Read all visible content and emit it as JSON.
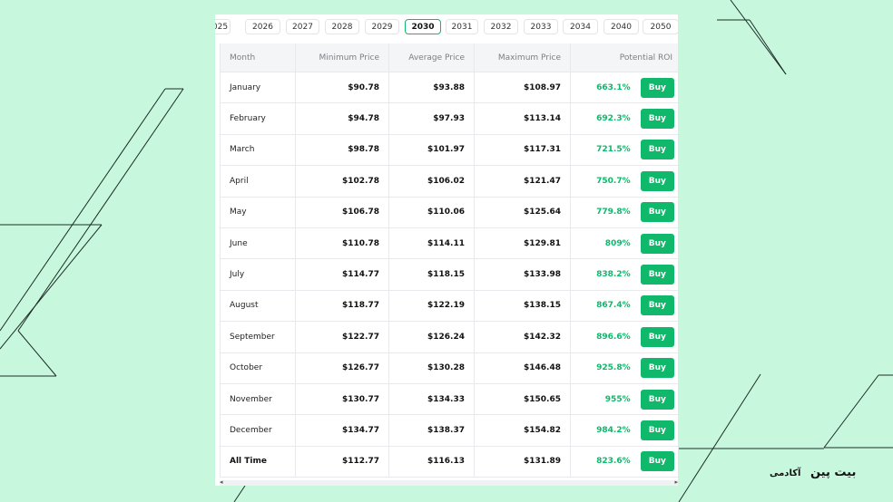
{
  "years": [
    "025",
    "2026",
    "2027",
    "2028",
    "2029",
    "2030",
    "2031",
    "2032",
    "2033",
    "2034",
    "2040",
    "2050"
  ],
  "active_year": "2030",
  "columns": {
    "month": "Month",
    "min": "Minimum Price",
    "avg": "Average Price",
    "max": "Maximum Price",
    "roi": "Potential ROI"
  },
  "buy_label": "Buy",
  "rows": [
    {
      "month": "January",
      "min": "$90.78",
      "avg": "$93.88",
      "max": "$108.97",
      "roi": "663.1%"
    },
    {
      "month": "February",
      "min": "$94.78",
      "avg": "$97.93",
      "max": "$113.14",
      "roi": "692.3%"
    },
    {
      "month": "March",
      "min": "$98.78",
      "avg": "$101.97",
      "max": "$117.31",
      "roi": "721.5%"
    },
    {
      "month": "April",
      "min": "$102.78",
      "avg": "$106.02",
      "max": "$121.47",
      "roi": "750.7%"
    },
    {
      "month": "May",
      "min": "$106.78",
      "avg": "$110.06",
      "max": "$125.64",
      "roi": "779.8%"
    },
    {
      "month": "June",
      "min": "$110.78",
      "avg": "$114.11",
      "max": "$129.81",
      "roi": "809%"
    },
    {
      "month": "July",
      "min": "$114.77",
      "avg": "$118.15",
      "max": "$133.98",
      "roi": "838.2%"
    },
    {
      "month": "August",
      "min": "$118.77",
      "avg": "$122.19",
      "max": "$138.15",
      "roi": "867.4%"
    },
    {
      "month": "September",
      "min": "$122.77",
      "avg": "$126.24",
      "max": "$142.32",
      "roi": "896.6%"
    },
    {
      "month": "October",
      "min": "$126.77",
      "avg": "$130.28",
      "max": "$146.48",
      "roi": "925.8%"
    },
    {
      "month": "November",
      "min": "$130.77",
      "avg": "$134.33",
      "max": "$150.65",
      "roi": "955%"
    },
    {
      "month": "December",
      "min": "$134.77",
      "avg": "$138.37",
      "max": "$154.82",
      "roi": "984.2%"
    },
    {
      "month": "All Time",
      "min": "$112.77",
      "avg": "$116.13",
      "max": "$131.89",
      "roi": "823.6%"
    }
  ],
  "brand": {
    "name": "بیت پین",
    "sub": "آکادمی"
  },
  "colors": {
    "background": "#c7f8de",
    "accent": "#0fb86a",
    "line": "#1c2b26"
  }
}
